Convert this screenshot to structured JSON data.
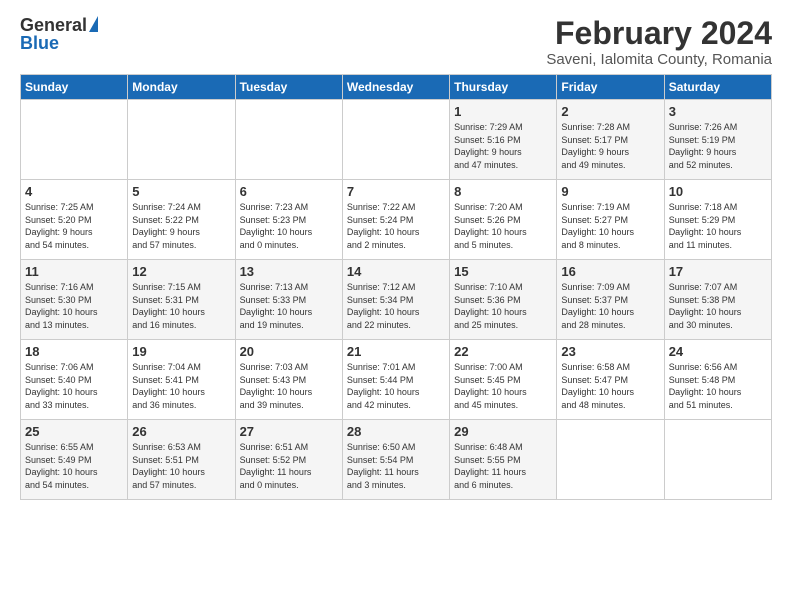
{
  "logo": {
    "general": "General",
    "blue": "Blue"
  },
  "title": "February 2024",
  "subtitle": "Saveni, Ialomita County, Romania",
  "days_header": [
    "Sunday",
    "Monday",
    "Tuesday",
    "Wednesday",
    "Thursday",
    "Friday",
    "Saturday"
  ],
  "weeks": [
    [
      {
        "day": "",
        "info": ""
      },
      {
        "day": "",
        "info": ""
      },
      {
        "day": "",
        "info": ""
      },
      {
        "day": "",
        "info": ""
      },
      {
        "day": "1",
        "info": "Sunrise: 7:29 AM\nSunset: 5:16 PM\nDaylight: 9 hours\nand 47 minutes."
      },
      {
        "day": "2",
        "info": "Sunrise: 7:28 AM\nSunset: 5:17 PM\nDaylight: 9 hours\nand 49 minutes."
      },
      {
        "day": "3",
        "info": "Sunrise: 7:26 AM\nSunset: 5:19 PM\nDaylight: 9 hours\nand 52 minutes."
      }
    ],
    [
      {
        "day": "4",
        "info": "Sunrise: 7:25 AM\nSunset: 5:20 PM\nDaylight: 9 hours\nand 54 minutes."
      },
      {
        "day": "5",
        "info": "Sunrise: 7:24 AM\nSunset: 5:22 PM\nDaylight: 9 hours\nand 57 minutes."
      },
      {
        "day": "6",
        "info": "Sunrise: 7:23 AM\nSunset: 5:23 PM\nDaylight: 10 hours\nand 0 minutes."
      },
      {
        "day": "7",
        "info": "Sunrise: 7:22 AM\nSunset: 5:24 PM\nDaylight: 10 hours\nand 2 minutes."
      },
      {
        "day": "8",
        "info": "Sunrise: 7:20 AM\nSunset: 5:26 PM\nDaylight: 10 hours\nand 5 minutes."
      },
      {
        "day": "9",
        "info": "Sunrise: 7:19 AM\nSunset: 5:27 PM\nDaylight: 10 hours\nand 8 minutes."
      },
      {
        "day": "10",
        "info": "Sunrise: 7:18 AM\nSunset: 5:29 PM\nDaylight: 10 hours\nand 11 minutes."
      }
    ],
    [
      {
        "day": "11",
        "info": "Sunrise: 7:16 AM\nSunset: 5:30 PM\nDaylight: 10 hours\nand 13 minutes."
      },
      {
        "day": "12",
        "info": "Sunrise: 7:15 AM\nSunset: 5:31 PM\nDaylight: 10 hours\nand 16 minutes."
      },
      {
        "day": "13",
        "info": "Sunrise: 7:13 AM\nSunset: 5:33 PM\nDaylight: 10 hours\nand 19 minutes."
      },
      {
        "day": "14",
        "info": "Sunrise: 7:12 AM\nSunset: 5:34 PM\nDaylight: 10 hours\nand 22 minutes."
      },
      {
        "day": "15",
        "info": "Sunrise: 7:10 AM\nSunset: 5:36 PM\nDaylight: 10 hours\nand 25 minutes."
      },
      {
        "day": "16",
        "info": "Sunrise: 7:09 AM\nSunset: 5:37 PM\nDaylight: 10 hours\nand 28 minutes."
      },
      {
        "day": "17",
        "info": "Sunrise: 7:07 AM\nSunset: 5:38 PM\nDaylight: 10 hours\nand 30 minutes."
      }
    ],
    [
      {
        "day": "18",
        "info": "Sunrise: 7:06 AM\nSunset: 5:40 PM\nDaylight: 10 hours\nand 33 minutes."
      },
      {
        "day": "19",
        "info": "Sunrise: 7:04 AM\nSunset: 5:41 PM\nDaylight: 10 hours\nand 36 minutes."
      },
      {
        "day": "20",
        "info": "Sunrise: 7:03 AM\nSunset: 5:43 PM\nDaylight: 10 hours\nand 39 minutes."
      },
      {
        "day": "21",
        "info": "Sunrise: 7:01 AM\nSunset: 5:44 PM\nDaylight: 10 hours\nand 42 minutes."
      },
      {
        "day": "22",
        "info": "Sunrise: 7:00 AM\nSunset: 5:45 PM\nDaylight: 10 hours\nand 45 minutes."
      },
      {
        "day": "23",
        "info": "Sunrise: 6:58 AM\nSunset: 5:47 PM\nDaylight: 10 hours\nand 48 minutes."
      },
      {
        "day": "24",
        "info": "Sunrise: 6:56 AM\nSunset: 5:48 PM\nDaylight: 10 hours\nand 51 minutes."
      }
    ],
    [
      {
        "day": "25",
        "info": "Sunrise: 6:55 AM\nSunset: 5:49 PM\nDaylight: 10 hours\nand 54 minutes."
      },
      {
        "day": "26",
        "info": "Sunrise: 6:53 AM\nSunset: 5:51 PM\nDaylight: 10 hours\nand 57 minutes."
      },
      {
        "day": "27",
        "info": "Sunrise: 6:51 AM\nSunset: 5:52 PM\nDaylight: 11 hours\nand 0 minutes."
      },
      {
        "day": "28",
        "info": "Sunrise: 6:50 AM\nSunset: 5:54 PM\nDaylight: 11 hours\nand 3 minutes."
      },
      {
        "day": "29",
        "info": "Sunrise: 6:48 AM\nSunset: 5:55 PM\nDaylight: 11 hours\nand 6 minutes."
      },
      {
        "day": "",
        "info": ""
      },
      {
        "day": "",
        "info": ""
      }
    ]
  ]
}
